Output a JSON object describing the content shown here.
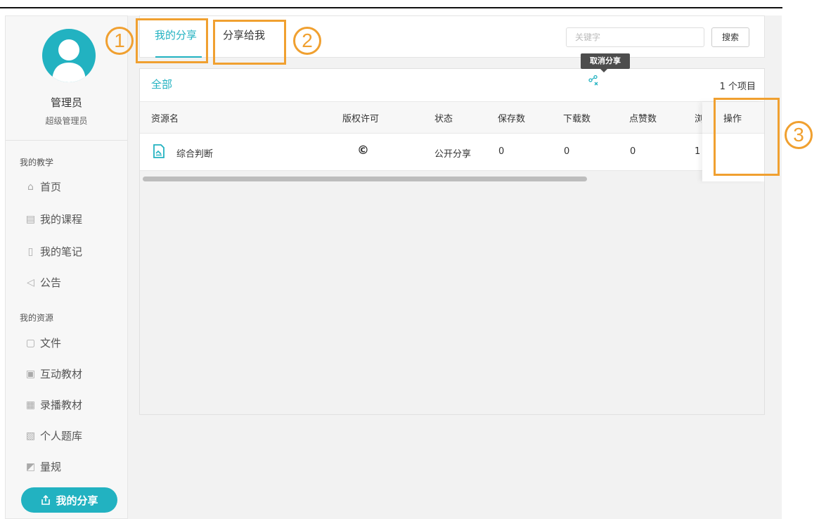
{
  "sidebar": {
    "user_name": "管理员",
    "user_role": "超级管理员",
    "teaching_label": "我的教学",
    "resources_label": "我的资源",
    "teaching_items": [
      {
        "label": "首页",
        "icon": "home-icon"
      },
      {
        "label": "我的课程",
        "icon": "course-icon"
      },
      {
        "label": "我的笔记",
        "icon": "notebook-icon"
      },
      {
        "label": "公告",
        "icon": "megaphone-icon"
      }
    ],
    "resource_items": [
      {
        "label": "文件",
        "icon": "file-icon"
      },
      {
        "label": "互动教材",
        "icon": "interactive-book-icon"
      },
      {
        "label": "录播教材",
        "icon": "recorded-lesson-icon"
      },
      {
        "label": "个人题库",
        "icon": "question-bank-icon"
      },
      {
        "label": "量规",
        "icon": "rubric-icon"
      }
    ],
    "active_item": {
      "label": "我的分享",
      "icon": "share-icon"
    }
  },
  "tabs": {
    "mine": "我的分享",
    "to_me": "分享给我"
  },
  "search": {
    "placeholder": "关键字",
    "button": "搜索"
  },
  "content": {
    "filter": "全部",
    "count": "1 个项目",
    "columns": [
      "资源名",
      "版权许可",
      "状态",
      "保存数",
      "下载数",
      "点赞数",
      "浏",
      "操作"
    ],
    "rows": [
      {
        "name": "综合判断",
        "license": "©",
        "status": "公开分享",
        "saves": "0",
        "downloads": "0",
        "likes": "0",
        "views": "1"
      }
    ],
    "tooltip": "取消分享"
  },
  "annotations": [
    "1",
    "2",
    "3"
  ],
  "colors": {
    "accent": "#22b2c1",
    "annotation": "#f0a030"
  }
}
